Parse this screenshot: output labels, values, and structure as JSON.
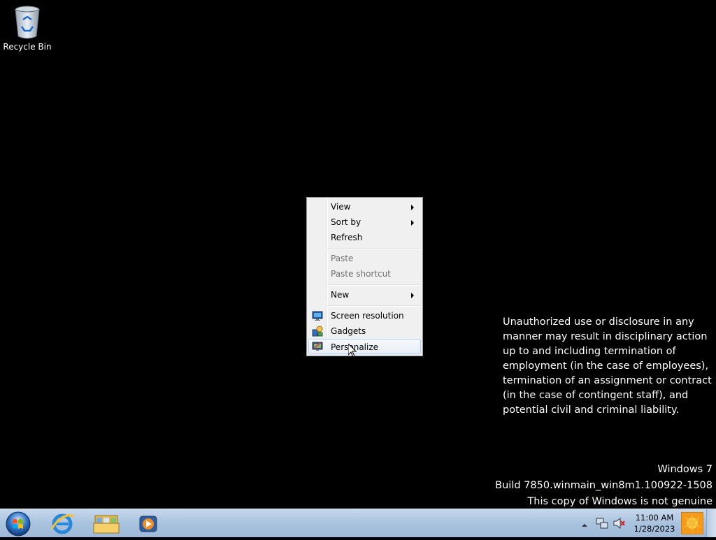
{
  "desktop": {
    "icons": [
      {
        "label": "Recycle Bin",
        "icon": "recycle-bin-icon"
      }
    ],
    "notice": "Unauthorized use or disclosure in any manner may result in disciplinary action up to and including termination of employment (in the case of employees), termination of an assignment or contract (in the case of contingent staff), and potential civil and criminal liability.",
    "watermark": {
      "line1": "Windows 7",
      "line2": "Build 7850.winmain_win8m1.100922-1508",
      "line3": "This copy of Windows is not genuine"
    }
  },
  "context_menu": {
    "items": [
      {
        "label": "View",
        "submenu": true
      },
      {
        "label": "Sort by",
        "submenu": true
      },
      {
        "label": "Refresh"
      },
      {
        "label": "Paste",
        "disabled": true
      },
      {
        "label": "Paste shortcut",
        "disabled": true
      },
      {
        "label": "New",
        "submenu": true
      },
      {
        "label": "Screen resolution",
        "icon": "monitor-icon"
      },
      {
        "label": "Gadgets",
        "icon": "gadgets-icon"
      },
      {
        "label": "Personalize",
        "icon": "personalize-icon",
        "highlighted": true
      }
    ]
  },
  "taskbar": {
    "pinned": [
      "start-orb",
      "internet-explorer-icon",
      "windows-explorer-icon",
      "media-player-icon"
    ],
    "clock": {
      "time": "11:00 AM",
      "date": "1/28/2023"
    }
  },
  "colors": {
    "desktop_bg": "#000000",
    "taskbar": "#a9c3df",
    "menu_bg": "#f0f0f0",
    "highlight_border": "#aecff7"
  }
}
